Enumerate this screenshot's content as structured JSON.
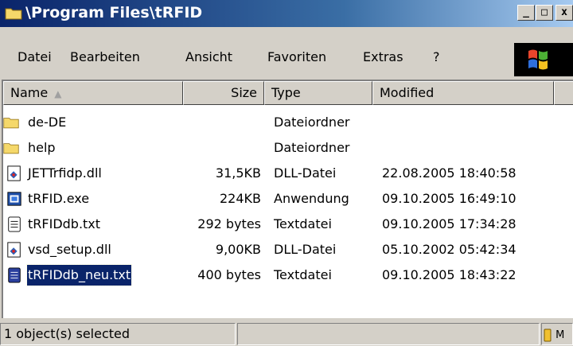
{
  "window": {
    "title": "\\Program Files\\tRFID",
    "minimize_glyph": "_",
    "maximize_glyph": "□",
    "close_glyph": "x"
  },
  "menu": [
    {
      "label": "Datei"
    },
    {
      "label": "Bearbeiten"
    },
    {
      "label": "Ansicht"
    },
    {
      "label": "Favoriten"
    },
    {
      "label": "Extras"
    },
    {
      "label": "?"
    }
  ],
  "columns": {
    "name": "Name",
    "size": "Size",
    "type": "Type",
    "modified": "Modified",
    "sort_glyph": "▲"
  },
  "files": [
    {
      "name": "de-DE",
      "size": "",
      "type": "Dateiordner",
      "modified": "",
      "icon": "folder-icon"
    },
    {
      "name": "help",
      "size": "",
      "type": "Dateiordner",
      "modified": "",
      "icon": "folder-icon"
    },
    {
      "name": "JETTrfidp.dll",
      "size": "31,5KB",
      "type": "DLL-Datei",
      "modified": "22.08.2005  18:40:58",
      "icon": "dll-icon"
    },
    {
      "name": "tRFID.exe",
      "size": "224KB",
      "type": "Anwendung",
      "modified": "09.10.2005  16:49:10",
      "icon": "exe-icon"
    },
    {
      "name": "tRFIDdb.txt",
      "size": "292 bytes",
      "type": "Textdatei",
      "modified": "09.10.2005  17:34:28",
      "icon": "text-file-icon"
    },
    {
      "name": "vsd_setup.dll",
      "size": "9,00KB",
      "type": "DLL-Datei",
      "modified": "05.10.2002  05:42:34",
      "icon": "dll-icon"
    },
    {
      "name": "tRFIDdb_neu.txt",
      "size": "400 bytes",
      "type": "Textdatei",
      "modified": "09.10.2005  18:43:22",
      "icon": "text-file-icon",
      "selected": true
    }
  ],
  "status": {
    "selection_text": "1 object(s) selected",
    "extra_text": "M"
  },
  "colors": {
    "selection": "#0a246a",
    "folder": "#f5d86a"
  }
}
